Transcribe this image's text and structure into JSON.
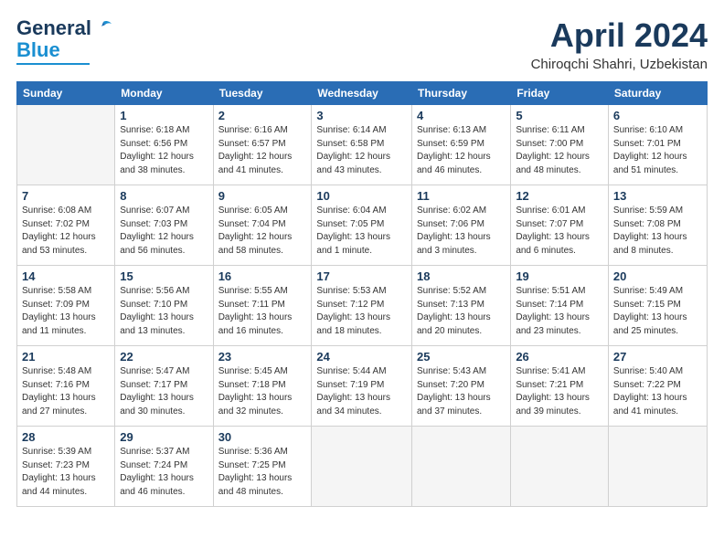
{
  "logo": {
    "line1": "General",
    "line2": "Blue"
  },
  "title": {
    "month_year": "April 2024",
    "location": "Chiroqchi Shahri, Uzbekistan"
  },
  "weekdays": [
    "Sunday",
    "Monday",
    "Tuesday",
    "Wednesday",
    "Thursday",
    "Friday",
    "Saturday"
  ],
  "weeks": [
    [
      {
        "day": "",
        "info": ""
      },
      {
        "day": "1",
        "info": "Sunrise: 6:18 AM\nSunset: 6:56 PM\nDaylight: 12 hours\nand 38 minutes."
      },
      {
        "day": "2",
        "info": "Sunrise: 6:16 AM\nSunset: 6:57 PM\nDaylight: 12 hours\nand 41 minutes."
      },
      {
        "day": "3",
        "info": "Sunrise: 6:14 AM\nSunset: 6:58 PM\nDaylight: 12 hours\nand 43 minutes."
      },
      {
        "day": "4",
        "info": "Sunrise: 6:13 AM\nSunset: 6:59 PM\nDaylight: 12 hours\nand 46 minutes."
      },
      {
        "day": "5",
        "info": "Sunrise: 6:11 AM\nSunset: 7:00 PM\nDaylight: 12 hours\nand 48 minutes."
      },
      {
        "day": "6",
        "info": "Sunrise: 6:10 AM\nSunset: 7:01 PM\nDaylight: 12 hours\nand 51 minutes."
      }
    ],
    [
      {
        "day": "7",
        "info": "Sunrise: 6:08 AM\nSunset: 7:02 PM\nDaylight: 12 hours\nand 53 minutes."
      },
      {
        "day": "8",
        "info": "Sunrise: 6:07 AM\nSunset: 7:03 PM\nDaylight: 12 hours\nand 56 minutes."
      },
      {
        "day": "9",
        "info": "Sunrise: 6:05 AM\nSunset: 7:04 PM\nDaylight: 12 hours\nand 58 minutes."
      },
      {
        "day": "10",
        "info": "Sunrise: 6:04 AM\nSunset: 7:05 PM\nDaylight: 13 hours\nand 1 minute."
      },
      {
        "day": "11",
        "info": "Sunrise: 6:02 AM\nSunset: 7:06 PM\nDaylight: 13 hours\nand 3 minutes."
      },
      {
        "day": "12",
        "info": "Sunrise: 6:01 AM\nSunset: 7:07 PM\nDaylight: 13 hours\nand 6 minutes."
      },
      {
        "day": "13",
        "info": "Sunrise: 5:59 AM\nSunset: 7:08 PM\nDaylight: 13 hours\nand 8 minutes."
      }
    ],
    [
      {
        "day": "14",
        "info": "Sunrise: 5:58 AM\nSunset: 7:09 PM\nDaylight: 13 hours\nand 11 minutes."
      },
      {
        "day": "15",
        "info": "Sunrise: 5:56 AM\nSunset: 7:10 PM\nDaylight: 13 hours\nand 13 minutes."
      },
      {
        "day": "16",
        "info": "Sunrise: 5:55 AM\nSunset: 7:11 PM\nDaylight: 13 hours\nand 16 minutes."
      },
      {
        "day": "17",
        "info": "Sunrise: 5:53 AM\nSunset: 7:12 PM\nDaylight: 13 hours\nand 18 minutes."
      },
      {
        "day": "18",
        "info": "Sunrise: 5:52 AM\nSunset: 7:13 PM\nDaylight: 13 hours\nand 20 minutes."
      },
      {
        "day": "19",
        "info": "Sunrise: 5:51 AM\nSunset: 7:14 PM\nDaylight: 13 hours\nand 23 minutes."
      },
      {
        "day": "20",
        "info": "Sunrise: 5:49 AM\nSunset: 7:15 PM\nDaylight: 13 hours\nand 25 minutes."
      }
    ],
    [
      {
        "day": "21",
        "info": "Sunrise: 5:48 AM\nSunset: 7:16 PM\nDaylight: 13 hours\nand 27 minutes."
      },
      {
        "day": "22",
        "info": "Sunrise: 5:47 AM\nSunset: 7:17 PM\nDaylight: 13 hours\nand 30 minutes."
      },
      {
        "day": "23",
        "info": "Sunrise: 5:45 AM\nSunset: 7:18 PM\nDaylight: 13 hours\nand 32 minutes."
      },
      {
        "day": "24",
        "info": "Sunrise: 5:44 AM\nSunset: 7:19 PM\nDaylight: 13 hours\nand 34 minutes."
      },
      {
        "day": "25",
        "info": "Sunrise: 5:43 AM\nSunset: 7:20 PM\nDaylight: 13 hours\nand 37 minutes."
      },
      {
        "day": "26",
        "info": "Sunrise: 5:41 AM\nSunset: 7:21 PM\nDaylight: 13 hours\nand 39 minutes."
      },
      {
        "day": "27",
        "info": "Sunrise: 5:40 AM\nSunset: 7:22 PM\nDaylight: 13 hours\nand 41 minutes."
      }
    ],
    [
      {
        "day": "28",
        "info": "Sunrise: 5:39 AM\nSunset: 7:23 PM\nDaylight: 13 hours\nand 44 minutes."
      },
      {
        "day": "29",
        "info": "Sunrise: 5:37 AM\nSunset: 7:24 PM\nDaylight: 13 hours\nand 46 minutes."
      },
      {
        "day": "30",
        "info": "Sunrise: 5:36 AM\nSunset: 7:25 PM\nDaylight: 13 hours\nand 48 minutes."
      },
      {
        "day": "",
        "info": ""
      },
      {
        "day": "",
        "info": ""
      },
      {
        "day": "",
        "info": ""
      },
      {
        "day": "",
        "info": ""
      }
    ]
  ]
}
